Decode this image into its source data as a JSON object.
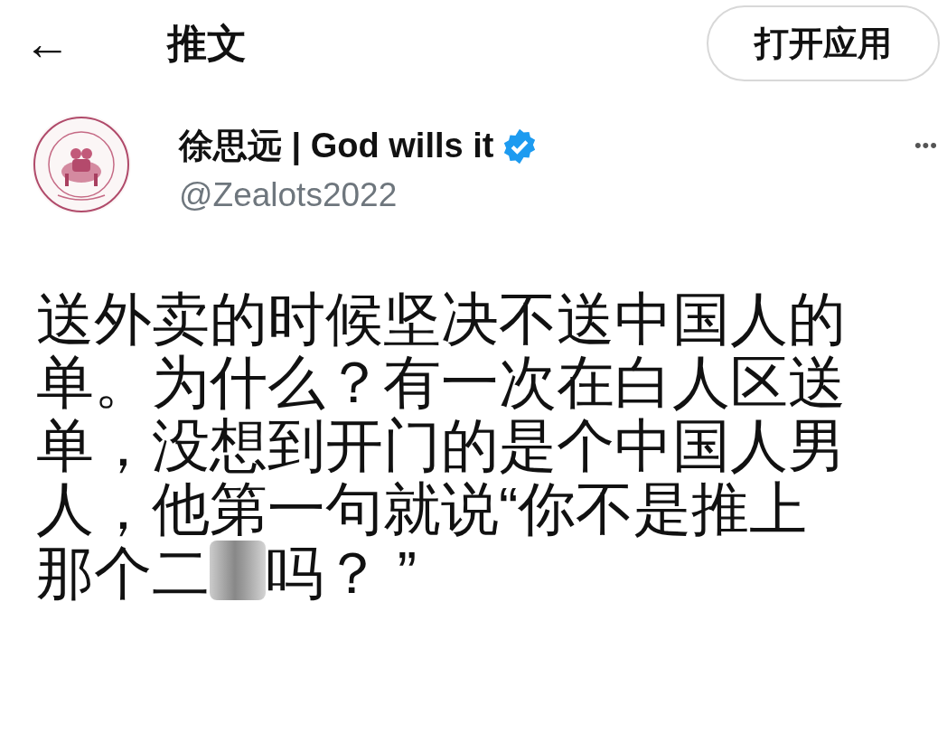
{
  "header": {
    "back": "←",
    "title": "推文",
    "open_app_button": "打开应用"
  },
  "tweet": {
    "author": {
      "name": "徐思远 | God wills it",
      "verified": true,
      "handle": "@Zealots2022"
    },
    "more": "•••",
    "lines": [
      "送外卖的时候坚决不送中国人的",
      "单。为什么？有一次在白人区送",
      "单，没想到开门的是个中国人男",
      "人，他第一句就说“你不是推上"
    ],
    "last_line": {
      "before_blur": "那个二",
      "after_blur": "吗？ ”"
    }
  }
}
